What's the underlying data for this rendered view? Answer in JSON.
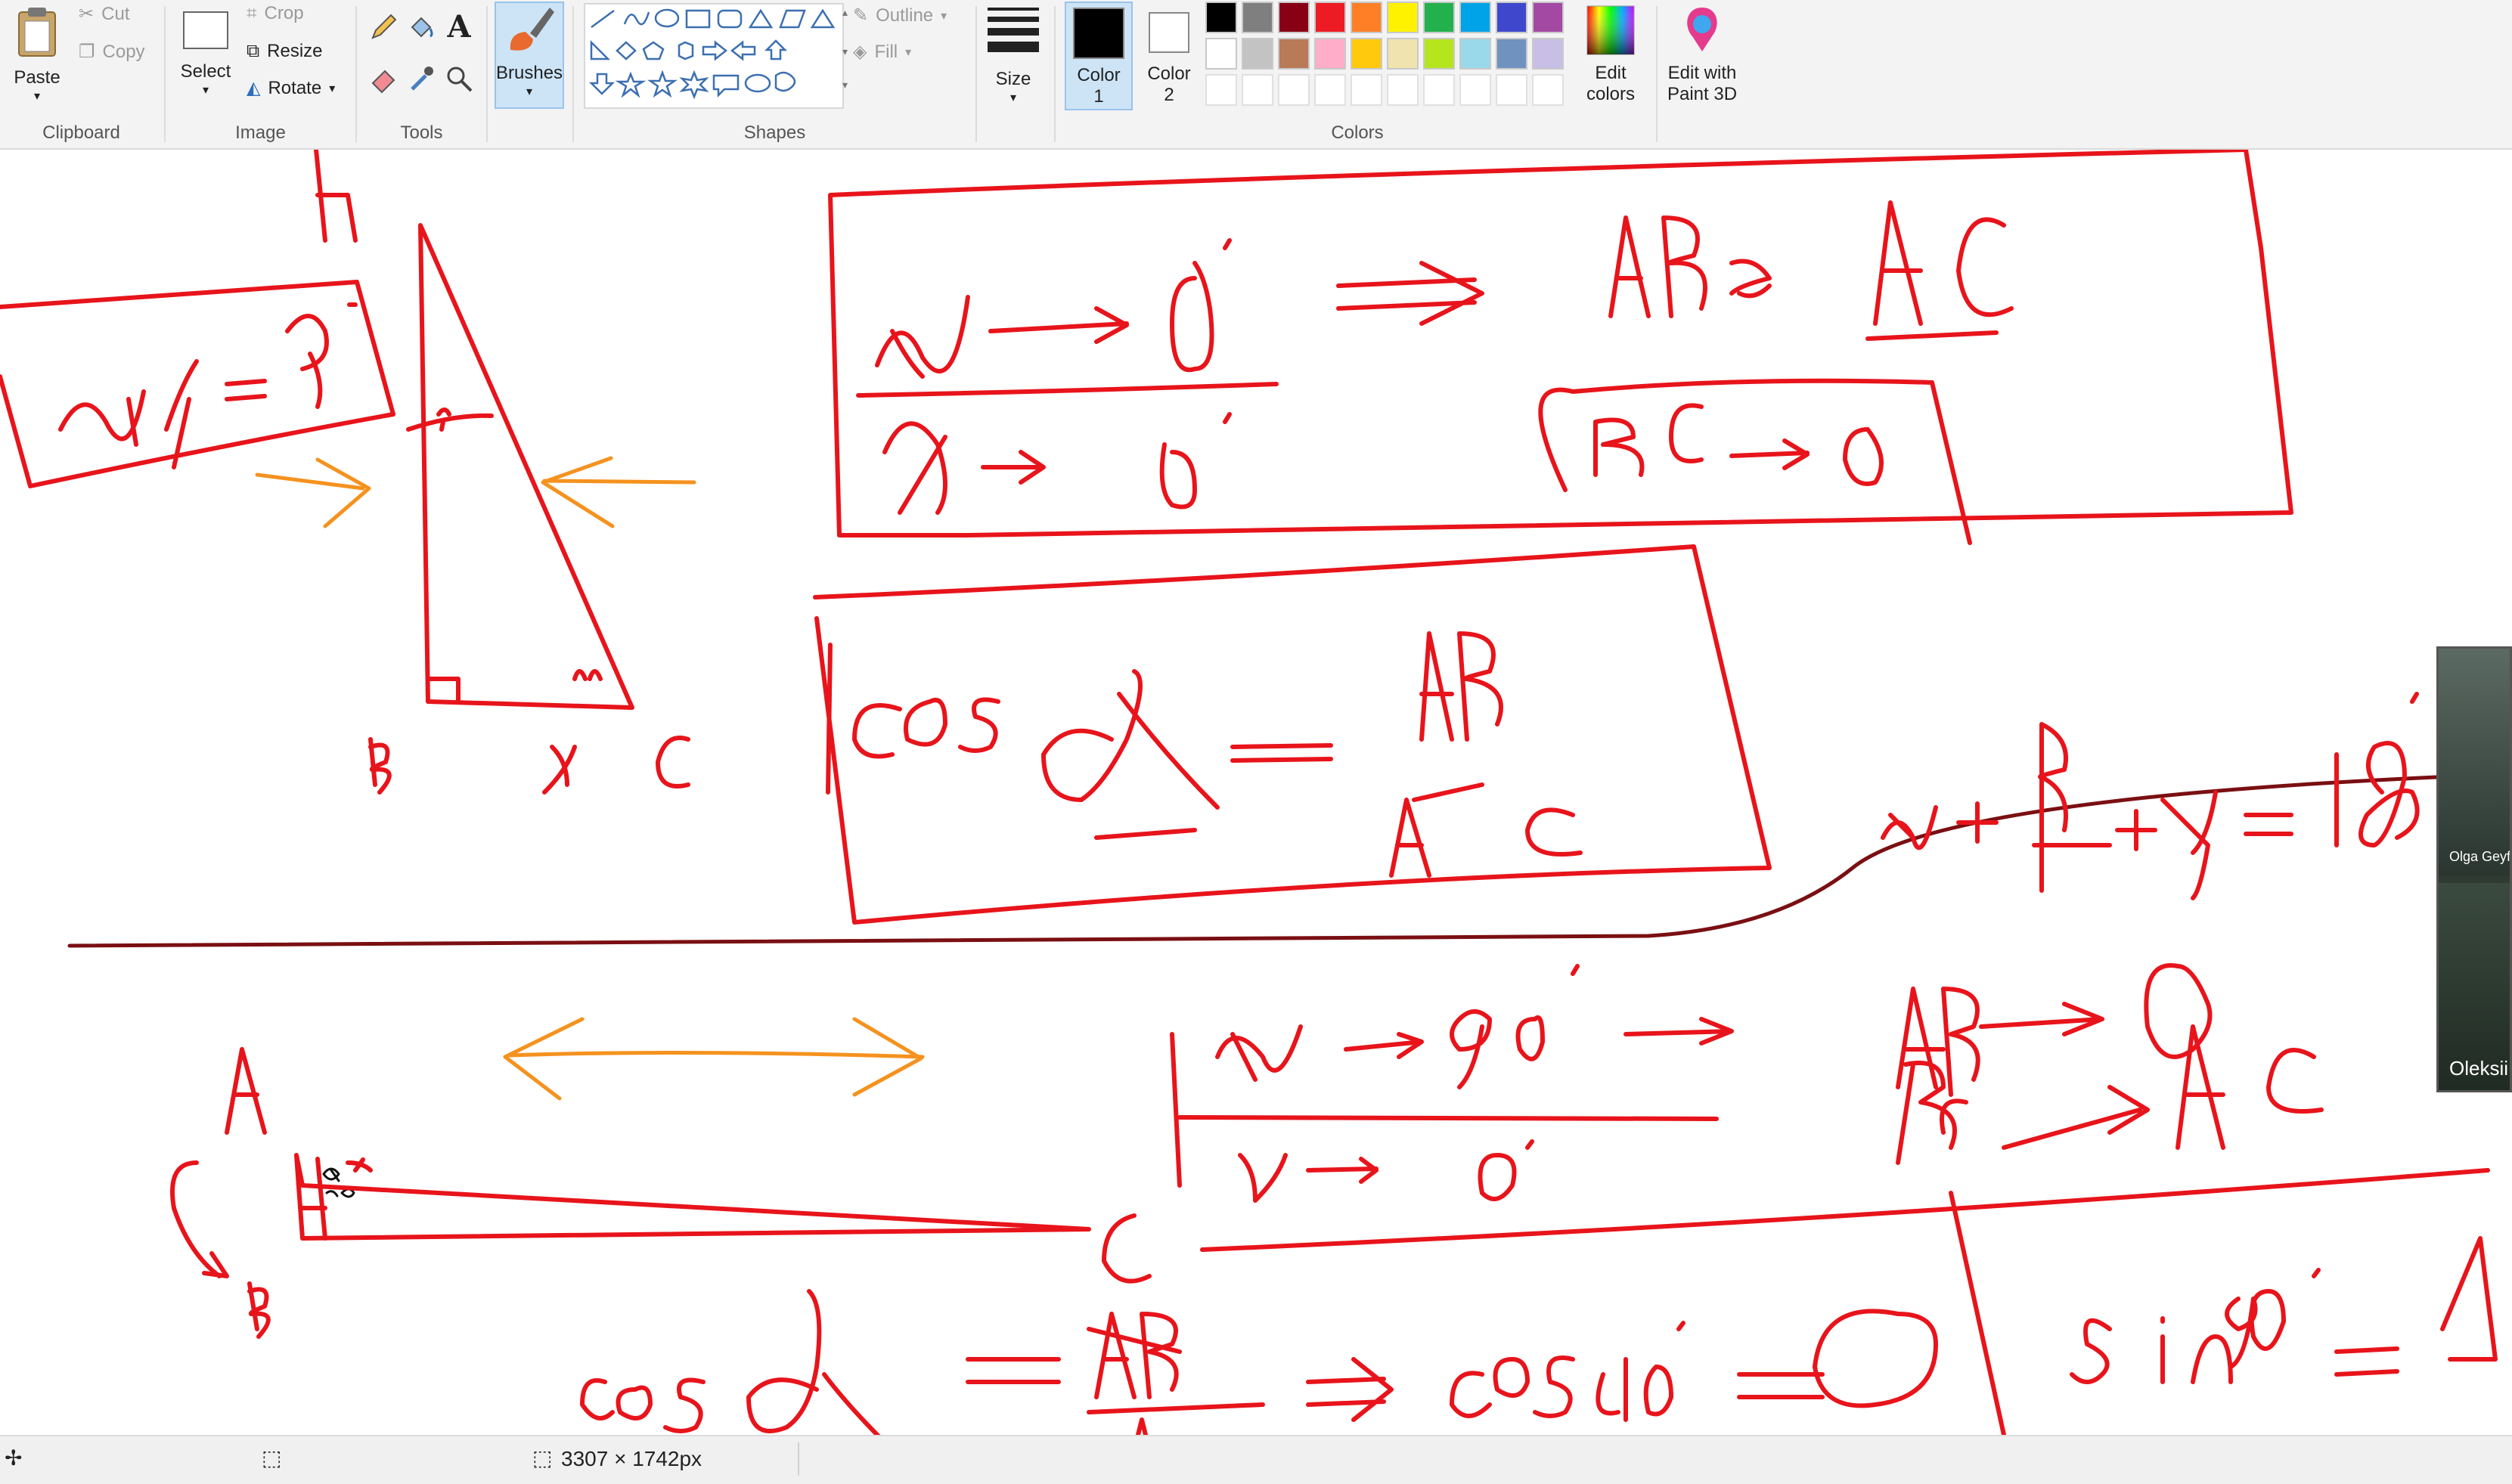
{
  "ribbon": {
    "clipboard": {
      "label": "Clipboard",
      "paste": "Paste",
      "cut": "Cut",
      "copy": "Copy"
    },
    "image": {
      "label": "Image",
      "select": "Select",
      "crop": "Crop",
      "resize": "Resize",
      "rotate": "Rotate"
    },
    "tools": {
      "label": "Tools",
      "text_glyph": "A"
    },
    "brushes": {
      "label": "Brushes"
    },
    "shapes": {
      "label": "Shapes",
      "outline": "Outline",
      "fill": "Fill"
    },
    "size": {
      "label": "Size"
    },
    "color1": {
      "line1": "Color",
      "line2": "1",
      "value": "#000000"
    },
    "color2": {
      "line1": "Color",
      "line2": "2",
      "value": "#ffffff"
    },
    "colors": {
      "label": "Colors",
      "palette_row1": [
        "#000000",
        "#7f7f7f",
        "#880015",
        "#ed1c24",
        "#ff7f27",
        "#fff200",
        "#22b14c",
        "#00a2e8",
        "#3f48cc",
        "#a349a4"
      ],
      "palette_row2": [
        "#ffffff",
        "#c3c3c3",
        "#b97a57",
        "#ffaec9",
        "#ffc90e",
        "#efe4b0",
        "#b5e61d",
        "#99d9ea",
        "#7092be",
        "#c8bfe7"
      ]
    },
    "edit_colors": {
      "line1": "Edit",
      "line2": "colors"
    },
    "paint3d": {
      "line1": "Edit with",
      "line2": "Paint 3D"
    }
  },
  "status": {
    "dimensions": "3307 × 1742px"
  },
  "video": {
    "participant1": "Olga Geyf",
    "participant2": "Oleksii"
  },
  "ink_colors": {
    "red": "#e8141b",
    "orange": "#f5921e",
    "darkred": "#7a0f12",
    "black": "#111111"
  }
}
